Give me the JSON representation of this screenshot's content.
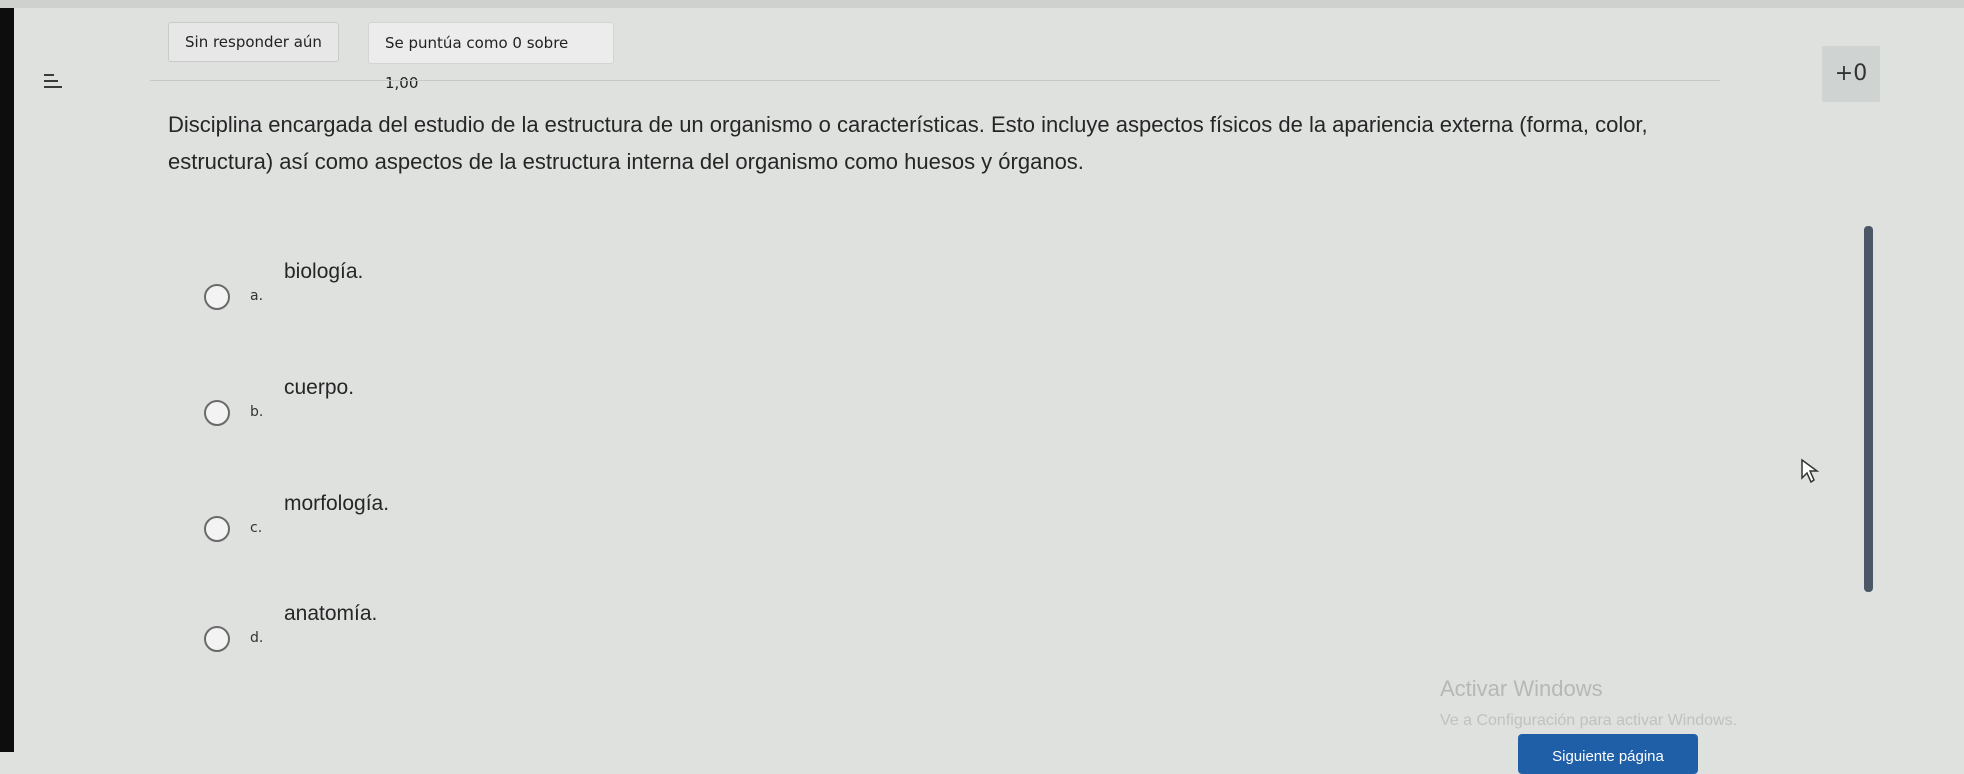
{
  "header": {
    "status": "Sin responder aún",
    "grade": "Se puntúa como 0 sobre 1,00",
    "flag_label": "+0"
  },
  "question": {
    "text": "Disciplina encargada del estudio de la estructura de un organismo o características. Esto incluye aspectos físicos de la apariencia externa (forma, color, estructura) así como aspectos de la estructura interna del organismo como huesos y órganos."
  },
  "options": [
    {
      "letter": "a.",
      "text": "biología."
    },
    {
      "letter": "b.",
      "text": "cuerpo."
    },
    {
      "letter": "c.",
      "text": "morfología."
    },
    {
      "letter": "d.",
      "text": "anatomía."
    }
  ],
  "watermark": {
    "title": "Activar Windows",
    "subtitle": "Ve a Configuración para activar Windows."
  },
  "footer": {
    "next_label": "Siguiente página"
  },
  "icons": {
    "menu": "hamburger-menu-icon",
    "cursor": "mouse-pointer-icon"
  },
  "colors": {
    "page_bg": "#dfe1df",
    "primary_button": "#1f5fa8",
    "scrollbar": "#4c5766"
  }
}
